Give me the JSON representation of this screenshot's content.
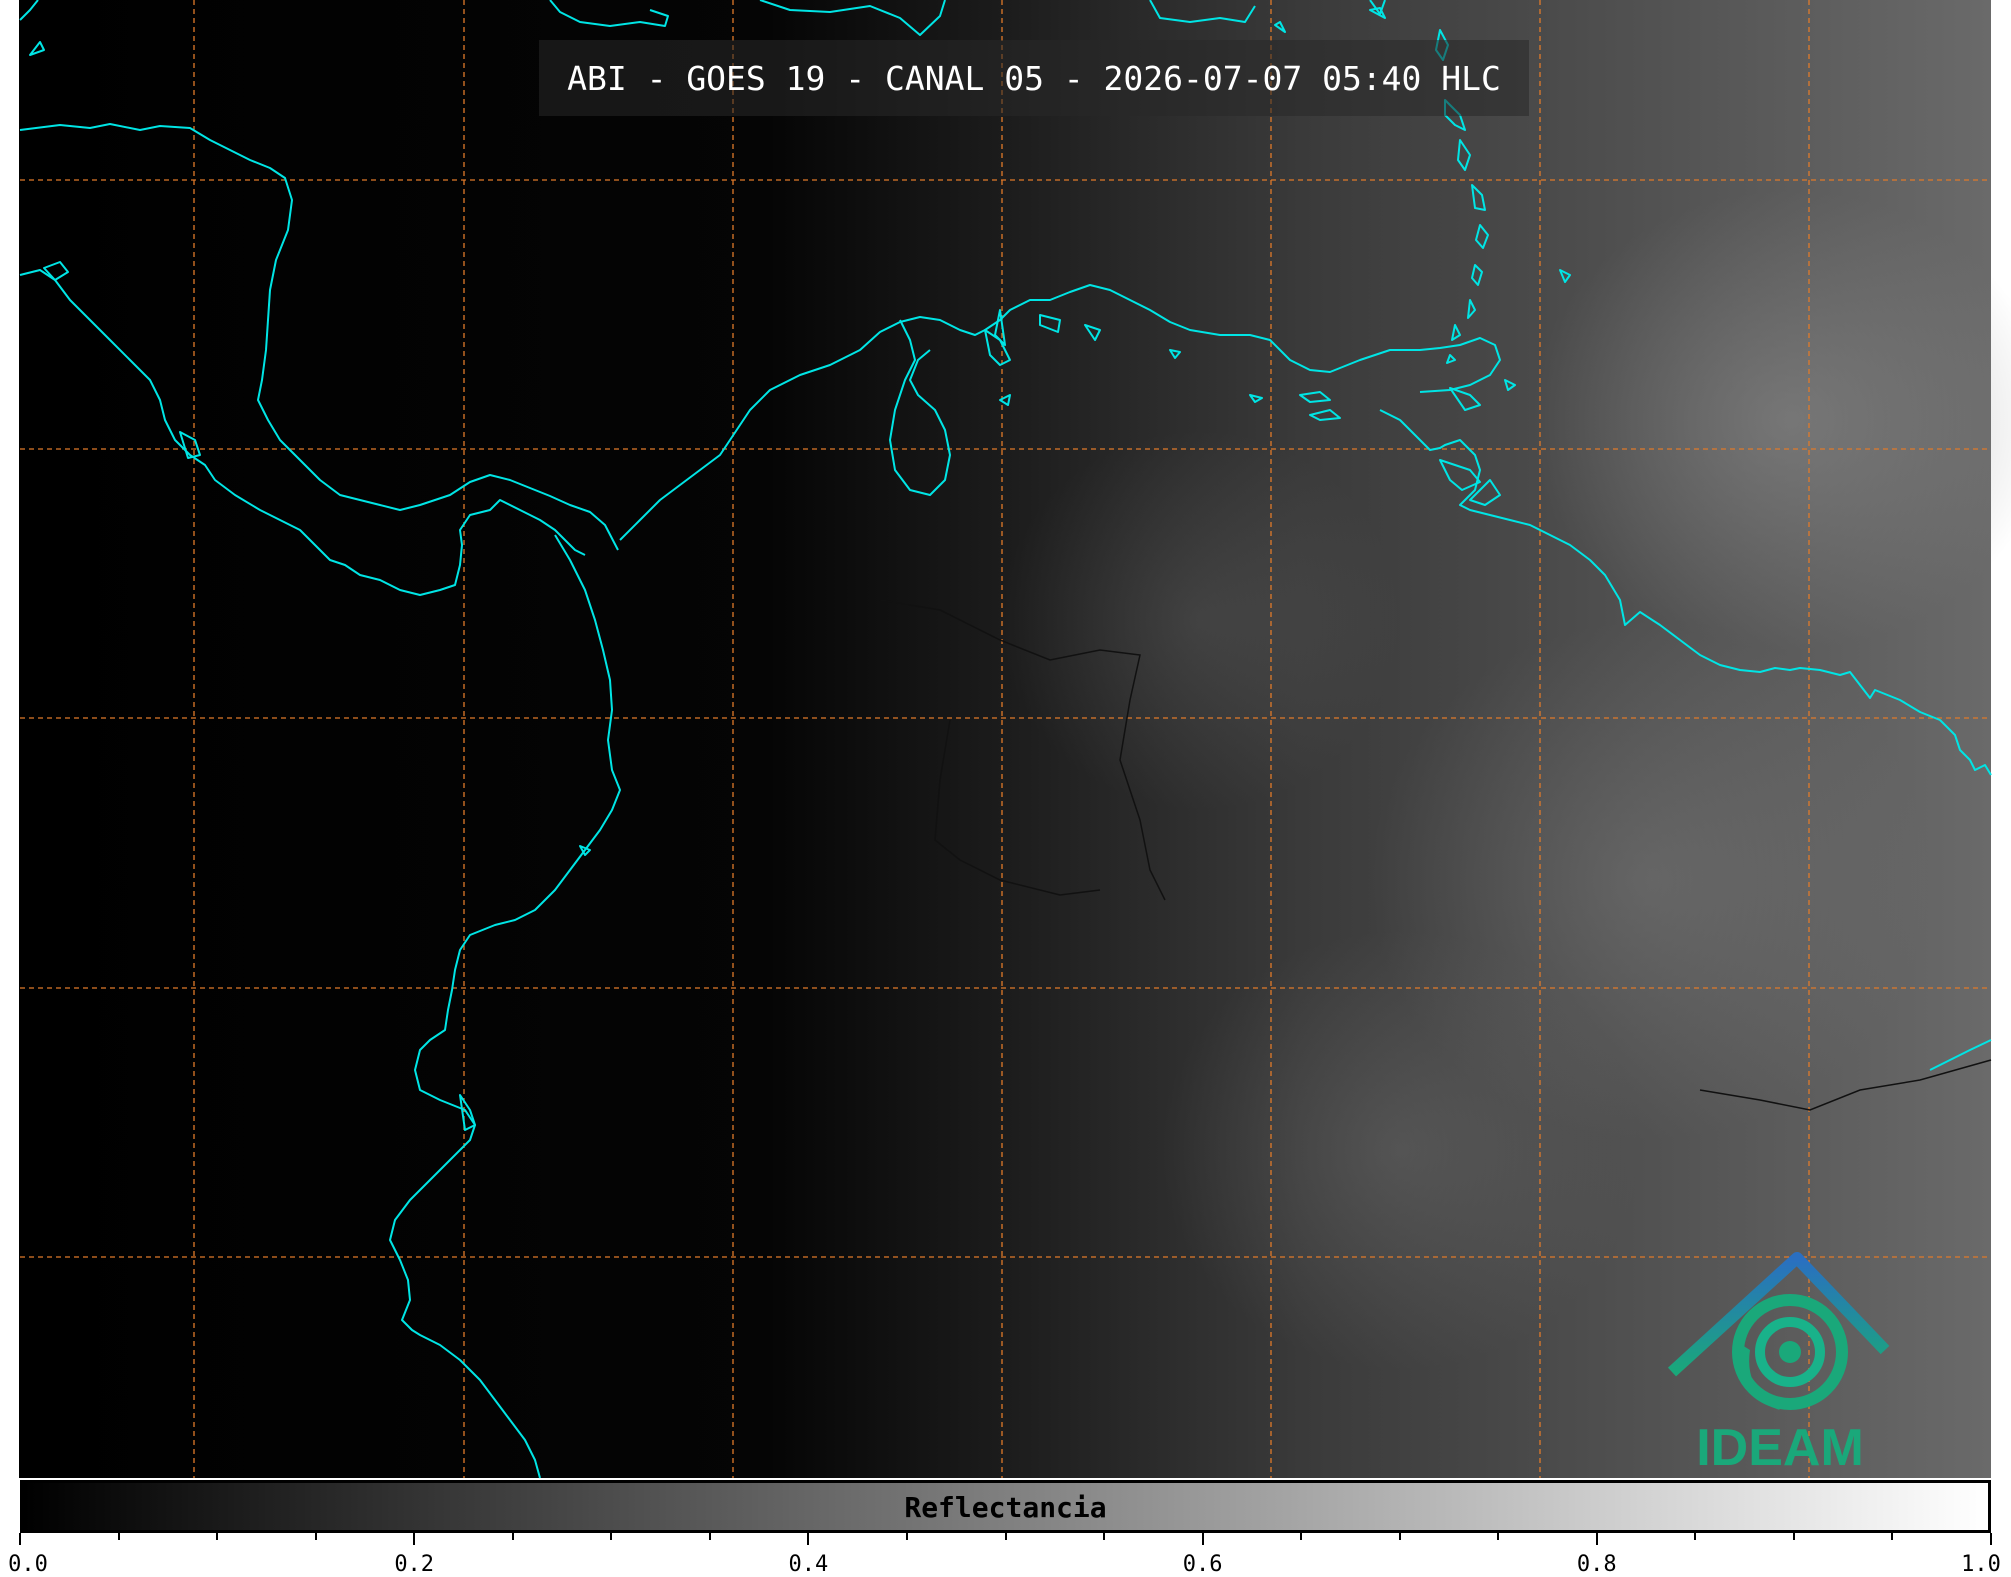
{
  "title": "ABI - GOES 19 - CANAL 05 - 2026-07-07 05:40 HLC",
  "colorbar": {
    "label": "Reflectancia",
    "ticks": [
      "0.0",
      "0.2",
      "0.4",
      "0.6",
      "0.8",
      "1.0"
    ],
    "range": [
      0.0,
      1.0
    ],
    "colormap": "grayscale"
  },
  "logo": {
    "text": "IDEAM"
  },
  "colors": {
    "coastline": "#00e5e5",
    "gridlines": "#e07a2a",
    "logo_blue": "#2a7bc0",
    "logo_teal": "#1aa87a"
  }
}
